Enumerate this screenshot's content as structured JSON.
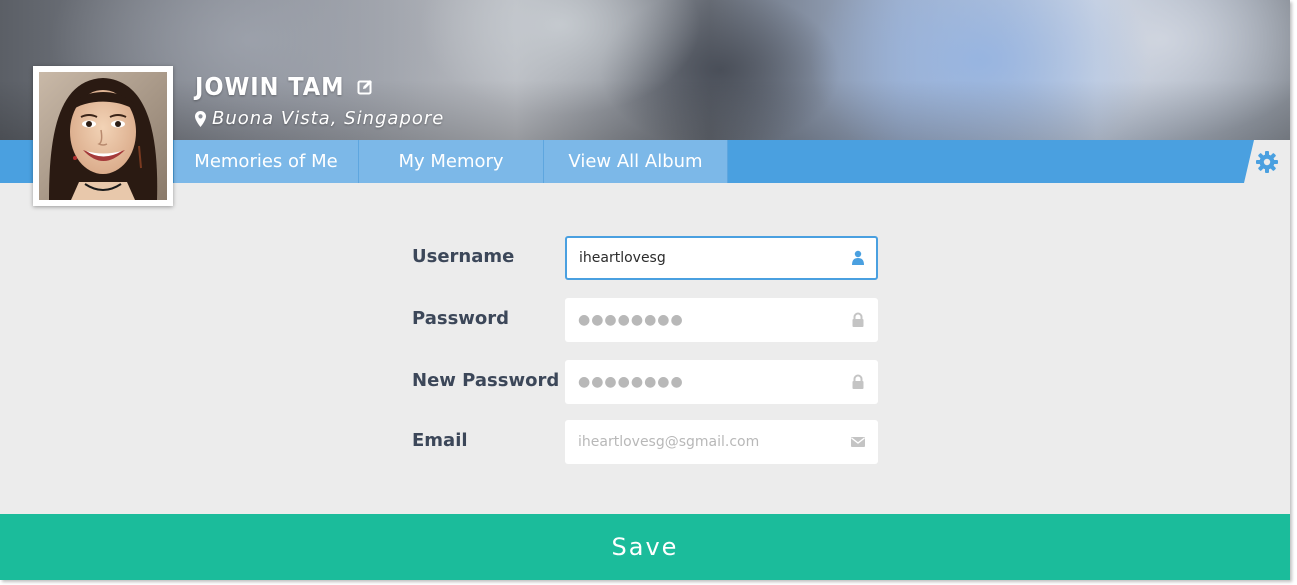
{
  "profile": {
    "name": "JOWIN TAM",
    "location": "Buona Vista, Singapore"
  },
  "nav": {
    "tabs": [
      {
        "label": "Memories of Me"
      },
      {
        "label": "My Memory"
      },
      {
        "label": "View All Album"
      }
    ]
  },
  "form": {
    "username": {
      "label": "Username",
      "value": "iheartlovesg"
    },
    "password": {
      "label": "Password",
      "value": "●●●●●●●●"
    },
    "new_password": {
      "label": "New Password",
      "value": "●●●●●●●●"
    },
    "email": {
      "label": "Email",
      "placeholder": "iheartlovesg@sgmail.com"
    }
  },
  "actions": {
    "save_label": "Save"
  },
  "colors": {
    "nav_blue": "#4aa0e0",
    "tab_blue": "#7cb8e8",
    "save_green": "#1bbc9b",
    "label_text": "#3c4759"
  },
  "icons": {
    "edit": "edit-icon",
    "location": "map-pin-icon",
    "settings": "gear-icon",
    "username": "user-icon",
    "password": "lock-icon",
    "email": "envelope-icon"
  }
}
